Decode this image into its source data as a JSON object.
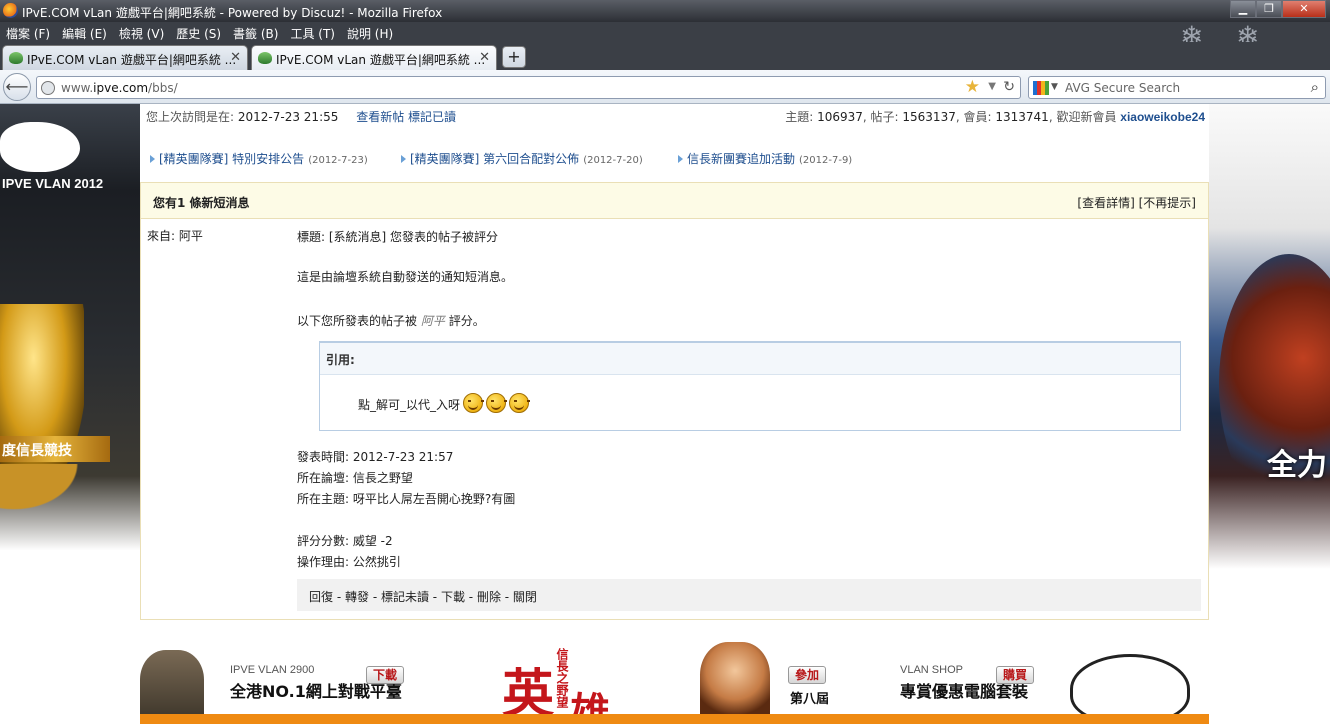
{
  "window": {
    "title": "IPvE.COM vLan 遊戲平台|網吧系統 - Powered by Discuz! - Mozilla Firefox"
  },
  "menu": [
    "檔案 (F)",
    "編輯 (E)",
    "檢視 (V)",
    "歷史 (S)",
    "書籤 (B)",
    "工具 (T)",
    "說明 (H)"
  ],
  "tabs": [
    {
      "label": "IPvE.COM vLan 遊戲平台|網吧系統 ..."
    },
    {
      "label": "IPvE.COM vLan 遊戲平台|網吧系統 ..."
    }
  ],
  "nav": {
    "url_prefix": "www.",
    "url_domain": "ipve.com",
    "url_path": "/bbs/",
    "search_placeholder": "AVG Secure Search"
  },
  "side": {
    "left_brand": "IPVE VLAN 2012",
    "left_banner": "度信長競技",
    "right_cta": "全力"
  },
  "info": {
    "last_visit_label": "您上次訪問是在:",
    "last_visit_time": "2012-7-23 21:55",
    "new_posts": "查看新帖",
    "mark_read": "標記已讀",
    "stats_prefix": "主題:",
    "topics": "106937",
    "posts_label": ", 帖子:",
    "posts": "1563137",
    "members_label": ", 會員:",
    "members": "1313741",
    "welcome_label": ", 歡迎新會員",
    "newest_member": "xiaoweikobe24"
  },
  "announcements": [
    {
      "title": "[精英團隊賽] 特別安排公告",
      "date": "(2012-7-23)"
    },
    {
      "title": "[精英團隊賽] 第六回合配對公佈",
      "date": "(2012-7-20)"
    },
    {
      "title": "信長新團賽追加活動",
      "date": "(2012-7-9)"
    }
  ],
  "pm": {
    "header_title": "您有1 條新短消息",
    "view_detail": "[查看詳情]",
    "no_remind": "[不再提示]",
    "from": "來自: 阿平",
    "subject": "標題: [系統消息] 您發表的帖子被評分",
    "line1": "這是由論壇系統自動發送的通知短消息。",
    "line2_before": "以下您所發表的帖子被",
    "line2_rater": "阿平",
    "line2_after": "評分。",
    "quote_label": "引用:",
    "quote_text": "點_解可_以代_入呀",
    "time": "發表時間: 2012-7-23 21:57",
    "forum": "所在論壇: 信長之野望",
    "topic": "所在主題: 呀平比人屌左吾開心挽野?有圖",
    "score": "評分分數: 威望 -2",
    "reason": "操作理由: 公然挑引",
    "actions": [
      "回復",
      "轉發",
      "標記未讀",
      "下載",
      "刪除",
      "關閉"
    ],
    "action_sep": " - "
  },
  "footer": {
    "vlan_small": "IPVE VLAN 2900",
    "vlan_big": "全港NO.1網上對戰平臺",
    "download_btn": "下載",
    "hero_c1": "英",
    "hero_c2": "雄",
    "hero_tag": "信長之野望",
    "join_btn": "參加",
    "round": "第八屆",
    "shop_small": "VLAN SHOP",
    "shop_big": "專賞優惠電腦套裝",
    "buy_btn": "購買"
  }
}
